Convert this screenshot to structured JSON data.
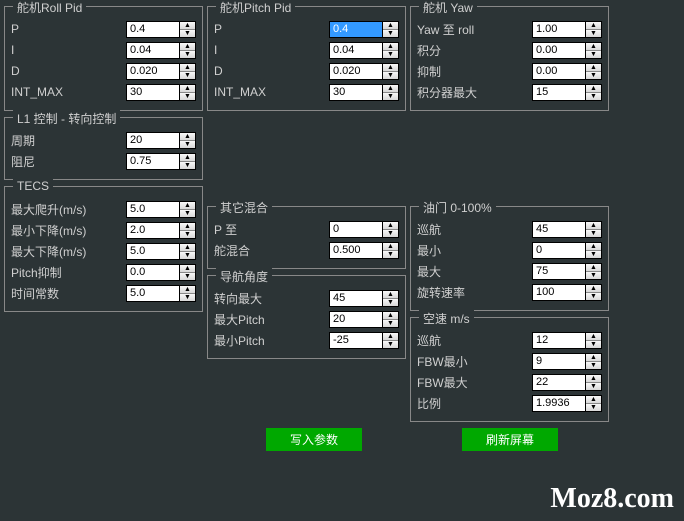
{
  "groups": {
    "rollPid": {
      "title": "舵机Roll Pid",
      "fields": [
        {
          "label": "P",
          "value": "0.4"
        },
        {
          "label": "I",
          "value": "0.04"
        },
        {
          "label": "D",
          "value": "0.020"
        },
        {
          "label": "INT_MAX",
          "value": "30"
        }
      ]
    },
    "pitchPid": {
      "title": "舵机Pitch Pid",
      "fields": [
        {
          "label": "P",
          "value": "0.4",
          "selected": true
        },
        {
          "label": "I",
          "value": "0.04"
        },
        {
          "label": "D",
          "value": "0.020"
        },
        {
          "label": "INT_MAX",
          "value": "30"
        }
      ]
    },
    "yaw": {
      "title": "舵机 Yaw",
      "fields": [
        {
          "label": "Yaw 至 roll",
          "value": "1.00"
        },
        {
          "label": "积分",
          "value": "0.00"
        },
        {
          "label": "抑制",
          "value": "0.00"
        },
        {
          "label": "积分器最大",
          "value": "15"
        }
      ]
    },
    "l1": {
      "title": "L1 控制 - 转向控制",
      "fields": [
        {
          "label": "周期",
          "value": "20"
        },
        {
          "label": "阻尼",
          "value": "0.75"
        }
      ]
    },
    "tecs": {
      "title": "TECS",
      "fields": [
        {
          "label": "最大爬升(m/s)",
          "value": "5.0"
        },
        {
          "label": "最小下降(m/s)",
          "value": "2.0"
        },
        {
          "label": "最大下降(m/s)",
          "value": "5.0"
        },
        {
          "label": "Pitch抑制",
          "value": "0.0"
        },
        {
          "label": "时间常数",
          "value": "5.0"
        }
      ]
    },
    "misc": {
      "title": "其它混合",
      "fields": [
        {
          "label": "P 至",
          "value": "0"
        },
        {
          "label": "舵混合",
          "value": "0.500"
        }
      ]
    },
    "throttle": {
      "title": "油门 0-100%",
      "fields": [
        {
          "label": "巡航",
          "value": "45"
        },
        {
          "label": "最小",
          "value": "0"
        },
        {
          "label": "最大",
          "value": "75"
        },
        {
          "label": "旋转速率",
          "value": "100"
        }
      ]
    },
    "nav": {
      "title": "导航角度",
      "fields": [
        {
          "label": "转向最大",
          "value": "45"
        },
        {
          "label": "最大Pitch",
          "value": "20"
        },
        {
          "label": "最小Pitch",
          "value": "-25"
        }
      ]
    },
    "airspeed": {
      "title": "空速 m/s",
      "fields": [
        {
          "label": "巡航",
          "value": "12"
        },
        {
          "label": "FBW最小",
          "value": "9"
        },
        {
          "label": "FBW最大",
          "value": "22"
        },
        {
          "label": "比例",
          "value": "1.9936"
        }
      ]
    }
  },
  "buttons": {
    "write": "写入参数",
    "refresh": "刷新屏幕"
  },
  "watermark": "Moz8.com"
}
